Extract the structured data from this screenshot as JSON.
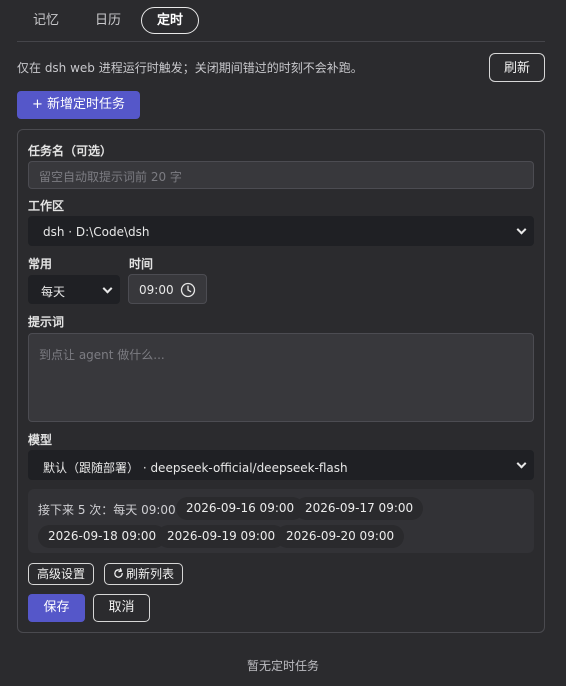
{
  "tabs": [
    {
      "label": "记忆"
    },
    {
      "label": "日历"
    },
    {
      "label": "定时"
    }
  ],
  "notice": "仅在 dsh web 进程运行时触发；关闭期间错过的时刻不会补跑。",
  "refresh_label": "刷新",
  "add_task_label": "+ 新增定时任务",
  "form": {
    "name_label": "任务名（可选）",
    "name_placeholder": "留空自动取提示词前 20 字",
    "workspace_label": "工作区",
    "workspace_value": "dsh · D:\\Code\\dsh",
    "frequency_label": "常用",
    "frequency_value": "每天",
    "time_label": "时间",
    "time_value": "09:00",
    "prompt_label": "提示词",
    "prompt_placeholder": "到点让 agent 做什么...",
    "model_label": "模型",
    "model_value": "默认（跟随部署） · deepseek-official/deepseek-flash",
    "schedule_prefix": "接下来 5 次：",
    "schedule_rule": "每天 09:00",
    "next_runs": [
      "2026-09-16 09:00",
      "2026-09-17 09:00",
      "2026-09-18 09:00",
      "2026-09-19 09:00",
      "2026-09-20 09:00"
    ],
    "advanced_label": "高级设置",
    "refresh_list_label": "刷新列表",
    "save_label": "保存",
    "cancel_label": "取消"
  },
  "empty_text": "暂无定时任务",
  "colors": {
    "accent": "#5557c9",
    "background": "#2b2b2e"
  },
  "icons": {
    "clock": "clock-icon",
    "refresh": "refresh-icon",
    "chevron": "chevron-down-icon"
  }
}
